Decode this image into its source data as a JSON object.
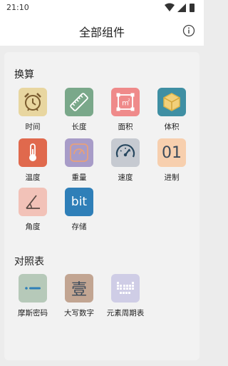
{
  "status": {
    "time": "21:10"
  },
  "header": {
    "title": "全部组件"
  },
  "sections": [
    {
      "title": "换算"
    },
    {
      "title": "对照表"
    }
  ],
  "items": {
    "time": {
      "label": "时间",
      "color": "#e8d6a0"
    },
    "length": {
      "label": "长度",
      "color": "#7aa88a"
    },
    "area": {
      "label": "面积",
      "color": "#ef8a8a"
    },
    "volume": {
      "label": "体积",
      "color": "#3f8fa3"
    },
    "temperature": {
      "label": "温度",
      "color": "#e0694d"
    },
    "weight": {
      "label": "重量",
      "color": "#a89cc8"
    },
    "speed": {
      "label": "速度",
      "color": "#c6cad1"
    },
    "radix": {
      "label": "进制",
      "color": "#f7cfae",
      "glyph": "01"
    },
    "angle": {
      "label": "角度",
      "color": "#f2c2b8"
    },
    "storage": {
      "label": "存储",
      "color": "#2f7fb8",
      "glyph": "bit"
    },
    "morse": {
      "label": "摩斯密码",
      "color": "#b6c9b9"
    },
    "uppercase_number": {
      "label": "大写数字",
      "color": "#c2a592",
      "glyph": "壹"
    },
    "periodic_table": {
      "label": "元素周期表",
      "color": "#cfcde6"
    }
  }
}
